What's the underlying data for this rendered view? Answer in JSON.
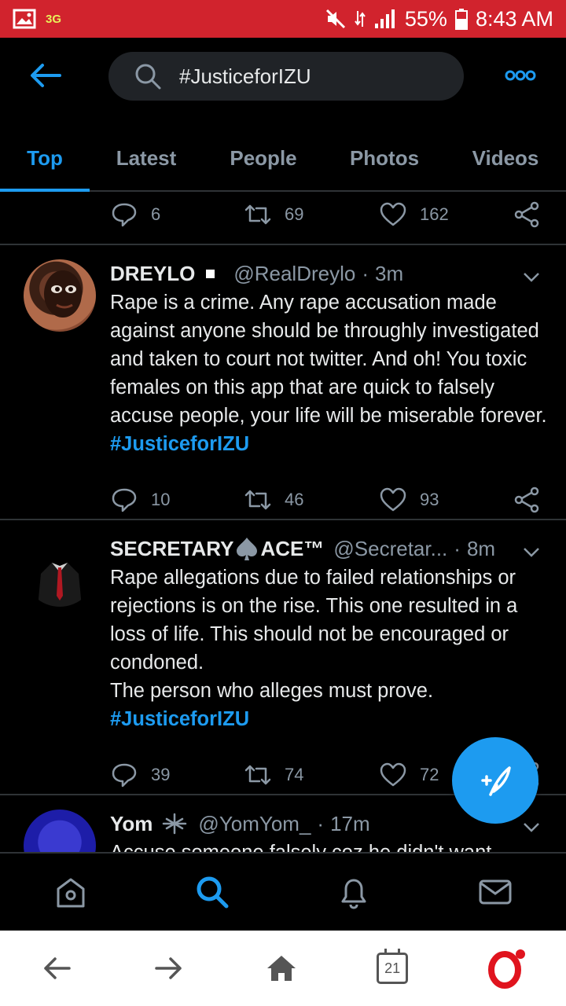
{
  "status_bar": {
    "network": "3G",
    "battery_percent": "55%",
    "time": "8:43 AM"
  },
  "search": {
    "query": "#JusticeforIZU"
  },
  "tabs": [
    {
      "label": "Top",
      "active": true
    },
    {
      "label": "Latest",
      "active": false
    },
    {
      "label": "People",
      "active": false
    },
    {
      "label": "Photos",
      "active": false
    },
    {
      "label": "Videos",
      "active": false
    }
  ],
  "partial_tweet": {
    "replies": "6",
    "retweets": "69",
    "likes": "162"
  },
  "tweets": [
    {
      "name": "DREYLO",
      "handle": "@RealDreylo",
      "time": "3m",
      "text": "Rape is a crime. Any rape accusation made against anyone should be throughly investigated and taken to court not twitter. And oh! You toxic females on this app that are quick to falsely accuse people, your life will be miserable forever.",
      "hashtag": "#JusticeforIZU",
      "replies": "10",
      "retweets": "46",
      "likes": "93"
    },
    {
      "name_a": "SECRETARY",
      "name_b": "ACE™",
      "handle": "@Secretar...",
      "time": "8m",
      "text_lines": [
        "Rape allegations due to failed relationships or rejections is on the rise. This one resulted in a loss of life. This should not be encouraged or condoned.",
        "The person who alleges must prove."
      ],
      "hashtag": "#JusticeforIZU",
      "replies": "39",
      "retweets": "74",
      "likes": "72"
    },
    {
      "name": "Yom",
      "handle": "@YomYom_",
      "time": "17m",
      "text": "Accuse someone falsely coz he didn't want"
    }
  ],
  "browser": {
    "tab_count": "21"
  },
  "colors": {
    "accent": "#1d9bf0",
    "status_bar": "#d1232d",
    "background": "#000000",
    "secondary_text": "#8b98a5",
    "opera_red": "#e0141e"
  }
}
